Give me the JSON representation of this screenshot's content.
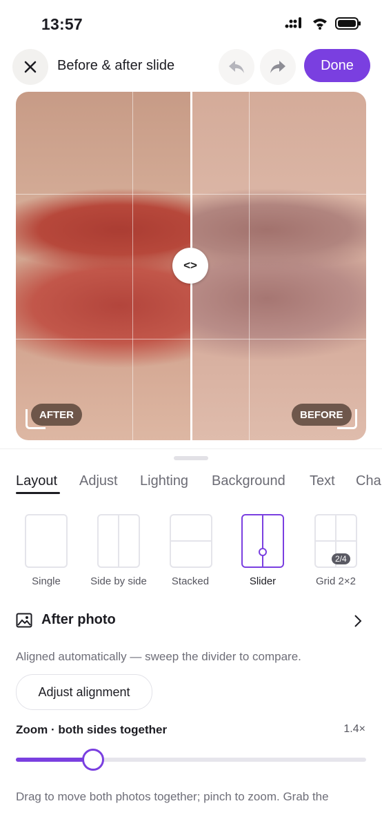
{
  "status_bar": {
    "time": "13:57"
  },
  "header": {
    "title": "Before & after slide",
    "done_label": "Done"
  },
  "photo": {
    "after_label": "AFTER",
    "before_label": "BEFORE",
    "handle_glyph": "<>"
  },
  "tabs": [
    {
      "label": "Layout",
      "active": true
    },
    {
      "label": "Adjust"
    },
    {
      "label": "Lighting"
    },
    {
      "label": "Background"
    },
    {
      "label": "Text"
    },
    {
      "label": "Cha"
    }
  ],
  "layouts": [
    {
      "label": "Single"
    },
    {
      "label": "Side by side"
    },
    {
      "label": "Stacked"
    },
    {
      "label": "Slider",
      "selected": true
    },
    {
      "label": "Grid 2×2",
      "badge": "2/4"
    }
  ],
  "after_photo": {
    "label": "After photo"
  },
  "alignment": {
    "hint": "Aligned automatically — sweep the divider to compare.",
    "button_label": "Adjust alignment"
  },
  "zoom": {
    "label": "Zoom · both sides together",
    "value_text": "1.4×",
    "level": 0.22
  },
  "footer_hint": "Drag to move both photos together; pinch to zoom. Grab the",
  "colors": {
    "accent": "#7a3fe0"
  }
}
